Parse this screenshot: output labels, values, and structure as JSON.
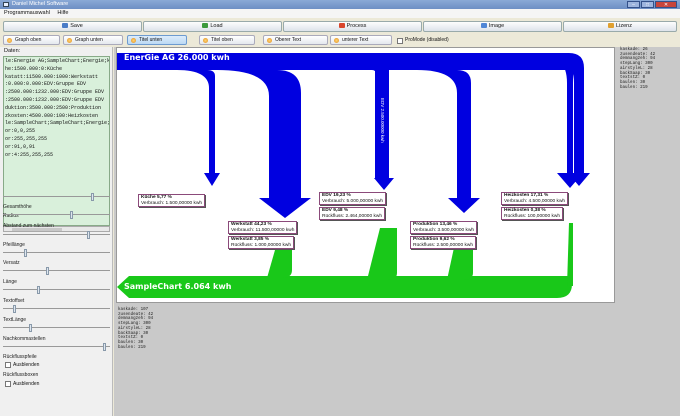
{
  "window": {
    "title": "Daniel Michel Software"
  },
  "menu": {
    "items": [
      "Programmauswahl",
      "Hilfe"
    ]
  },
  "toolbar": {
    "buttons": [
      {
        "label": "Save",
        "icon": "save-icon",
        "color": "#4a7cc7"
      },
      {
        "label": "Load",
        "icon": "load-icon",
        "color": "#3c9a3c"
      },
      {
        "label": "Process",
        "icon": "process-icon",
        "color": "#d9452c"
      },
      {
        "label": "Image",
        "icon": "image-icon",
        "color": "#4f86d6"
      },
      {
        "label": "Lizenz",
        "icon": "license-icon",
        "color": "#e0a030"
      }
    ]
  },
  "options": {
    "buttons": [
      "Graph oben",
      "Graph unten",
      "Titel unten",
      "Titel oben",
      "Oberer Text",
      "unterer Text"
    ],
    "checkbox": "ProMode (disabled)"
  },
  "left": {
    "data_label": "Daten:",
    "lines": [
      "le:Energie AG;SampleChart;Energie;kwh",
      "he:1500.000:0:Küche",
      "katatt:11500.000:1000:Werkstatt",
      ":0.000:0.000:EDV:Gruppe EDV",
      ":2500.000:1232.000:EDV:Gruppe EDV",
      ":2500.000:1232.000:EDV:Gruppe EDV",
      "duktion:3500.000:2500:Produktion",
      "zkosten:4500.000:100:Heizkosten",
      "le:SampleChart;SampleChart;Energie;kwh",
      "or:0,0,255",
      "or:255,255,255",
      "or:91,0,91",
      "or:4:255,255,255"
    ],
    "sliders": [
      {
        "label": "Radius",
        "value": 0.85
      },
      {
        "label": "Gesamthöhe",
        "value": 0.65
      },
      {
        "label": "Abstand zum nächsten",
        "value": 0.82
      },
      {
        "label": "Pfeillänge",
        "value": 0.2
      },
      {
        "label": "Versatz",
        "value": 0.42
      },
      {
        "label": "Länge",
        "value": 0.33
      },
      {
        "label": "Textoffset",
        "value": 0.1
      },
      {
        "label": "TextLänge",
        "value": 0.25
      },
      {
        "label": "Nachkommastellen",
        "value": 0.97
      }
    ],
    "check1": {
      "heading": "Rückflusspfeile",
      "label": "Ausblenden"
    },
    "check2": {
      "heading": "Rückflussboxen",
      "label": "Ausblenden"
    }
  },
  "chart": {
    "title_top": "EnerGie AG 26.000 kwh",
    "title_bottom": "SampleChart 6.064 kwh",
    "edv_vertical": "EDV 2.500.00000 kwh",
    "colors": {
      "main": "#0000e0",
      "return": "#19c819",
      "node_border": "#8b4a7a"
    },
    "nodes": [
      {
        "title": "Küche 5,77 %",
        "line": "Verbrauch: 1.500,00000 kwh"
      },
      {
        "title": "Werkstatt 44,23 %",
        "line": "Verbrauch: 11.500,00000 kwh"
      },
      {
        "title": "Werkstatt 3,85 %",
        "line": "Rückfluss: 1.000,00000 kwh"
      },
      {
        "title": "EDV 19,23 %",
        "line": "Verbrauch: 5.000,00000 kwh"
      },
      {
        "title": "EDV 9,48 %",
        "line": "Rückfluss: 2.464,00000 kwh"
      },
      {
        "title": "Produktion 13,46 %",
        "line": "Verbrauch: 3.500,00000 kwh"
      },
      {
        "title": "Produktion 9,62 %",
        "line": "Rückfluss: 2.500,00000 kwh"
      },
      {
        "title": "Heizkosten 17,31 %",
        "line": "Verbrauch: 4.500,00000 kwh"
      },
      {
        "title": "Heizkosten 0,38 %",
        "line": "Rückfluss: 100,00000 kwh"
      }
    ]
  },
  "info_right": "kaskade: 26\nzusendeate: 42\ndemnangzeh: 94\nstepLang: 300\nairstyleL: 28\nbackSaap: 30\ntextstZ: 0\nbaulen: 30\nbaulen: 219",
  "info_bottom": "kaskade: 107\nzusendeate: 42\ndemnangzeh: 94\nstepLang: 300\nairstyleL: 28\nbackSaap: 30\ntextstZ: 0\nbaulen: 30\nbaulen: 219"
}
